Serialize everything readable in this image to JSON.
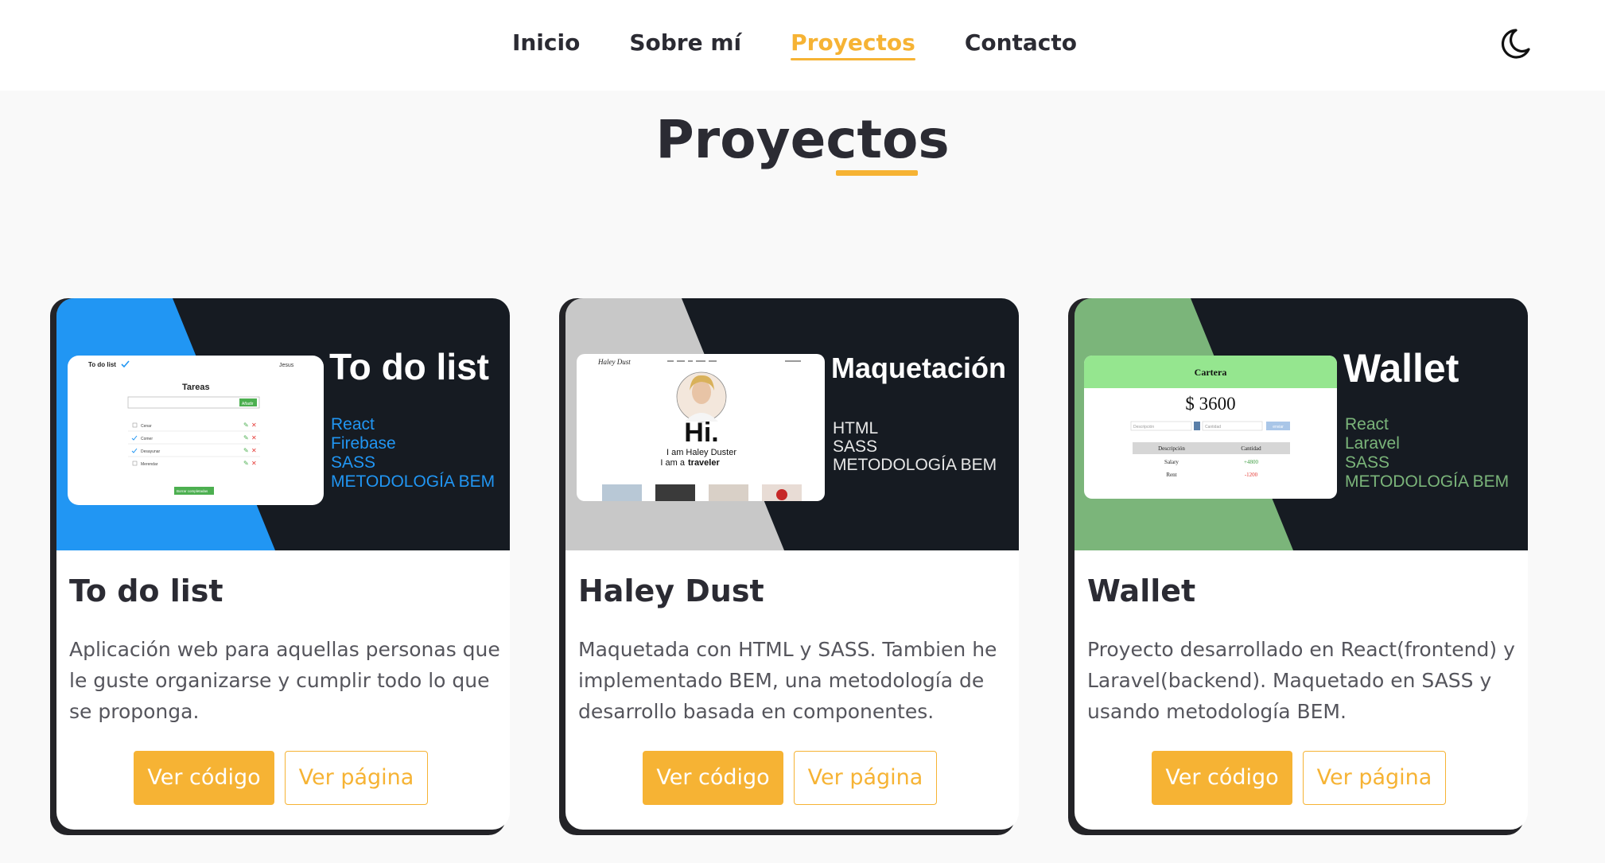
{
  "nav": {
    "links": [
      "Inicio",
      "Sobre mí",
      "Proyectos",
      "Contacto"
    ],
    "active_index": 2,
    "theme_icon": "moon-icon"
  },
  "section": {
    "title": "Proyectos"
  },
  "colors": {
    "accent": "#f6b334",
    "dark": "#161b22",
    "text": "#2b2b33"
  },
  "projects": [
    {
      "title": "To do list",
      "description": "Aplicación web para aquellas personas que le guste organizarse y cumplir todo lo que se proponga.",
      "code_label": "Ver código",
      "page_label": "Ver página",
      "thumb": {
        "heading": "To do list",
        "accent_color": "#2196f3",
        "tech": [
          "React",
          "Firebase",
          "SASS",
          "METODOLOGÍA BEM"
        ],
        "mock": {
          "app_name": "To do list",
          "user": "Jesus",
          "panel_title": "Tareas",
          "add_button": "Añadir",
          "tasks": [
            "Cenar",
            "Comer",
            "Desayunar",
            "Merendar"
          ],
          "clear_button": "Borrar completadas"
        }
      }
    },
    {
      "title": "Haley Dust",
      "description": "Maquetada con HTML y SASS. Tambien he implementado BEM, una metodología de desarrollo basada en componentes.",
      "code_label": "Ver código",
      "page_label": "Ver página",
      "thumb": {
        "heading": "Maquetación",
        "accent_color": "#c8c8c8",
        "tech": [
          "HTML",
          "SASS",
          "METODOLOGÍA BEM"
        ],
        "mock": {
          "logo": "Haley Dust",
          "greeting": "Hi.",
          "line1": "I am Haley Duster",
          "line2_prefix": "I am a",
          "line2_bold": "traveler"
        }
      }
    },
    {
      "title": "Wallet",
      "description": "Proyecto desarrollado en React(frontend) y Laravel(backend). Maquetado en SASS y usando metodología BEM.",
      "code_label": "Ver código",
      "page_label": "Ver página",
      "thumb": {
        "heading": "Wallet",
        "accent_color": "#7bb57a",
        "tech": [
          "React",
          "Laravel",
          "SASS",
          "METODOLOGÍA BEM"
        ],
        "mock": {
          "header": "Cartera",
          "balance": "$ 3600",
          "placeholder_desc": "Descripción",
          "placeholder_amount": "Cantidad",
          "submit": "enviar",
          "columns": [
            "Descripción",
            "Cantidad"
          ],
          "rows": [
            [
              "Salary",
              "+4800"
            ],
            [
              "Rent",
              "-1200"
            ]
          ]
        }
      }
    }
  ]
}
